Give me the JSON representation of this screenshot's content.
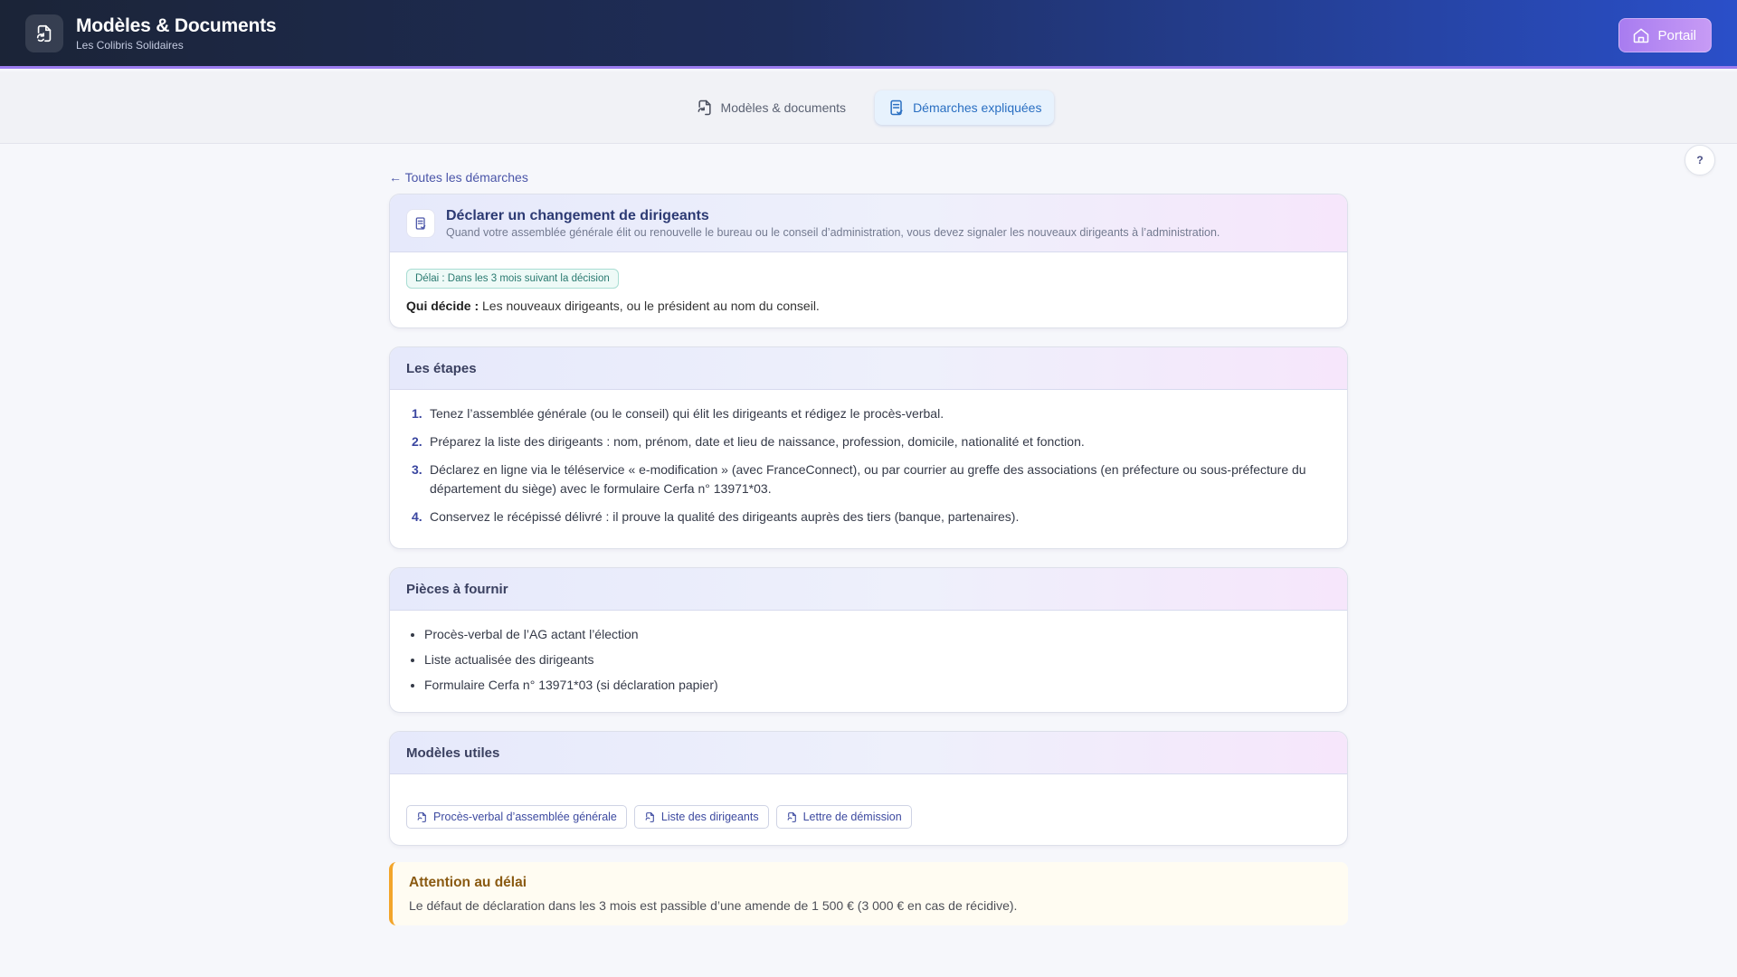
{
  "header": {
    "title": "Modèles & Documents",
    "subtitle": "Les Colibris Solidaires",
    "portal_label": "Portail"
  },
  "tabs": [
    {
      "label": "Modèles & documents",
      "icon": "document-icon",
      "active": false
    },
    {
      "label": "Démarches expliquées",
      "icon": "checklist-icon",
      "active": true
    }
  ],
  "help_label": "?",
  "back_link": "← Toutes les démarches",
  "procedure": {
    "title": "Déclarer un changement de dirigeants",
    "description": "Quand votre assemblée générale élit ou renouvelle le bureau ou le conseil d’administration, vous devez signaler les nouveaux dirigeants à l’administration.",
    "deadline_badge": "Délai : Dans les 3 mois suivant la décision",
    "who_label": "Qui décide :",
    "who_text": "Les nouveaux dirigeants, ou le président au nom du conseil."
  },
  "steps": {
    "heading": "Les étapes",
    "items": [
      {
        "num": "1.",
        "text": "Tenez l’assemblée générale (ou le conseil) qui élit les dirigeants et rédigez le procès-verbal."
      },
      {
        "num": "2.",
        "text": "Préparez la liste des dirigeants : nom, prénom, date et lieu de naissance, profession, domicile, nationalité et fonction."
      },
      {
        "num": "3.",
        "text": "Déclarez en ligne via le téléservice « e-modification » (avec FranceConnect), ou par courrier au greffe des associations (en préfecture ou sous-préfecture du département du siège) avec le formulaire Cerfa n° 13971*03."
      },
      {
        "num": "4.",
        "text": "Conservez le récépissé délivré : il prouve la qualité des dirigeants auprès des tiers (banque, partenaires)."
      }
    ]
  },
  "documents": {
    "heading": "Pièces à fournir",
    "items": [
      "Procès-verbal de l’AG actant l’élection",
      "Liste actualisée des dirigeants",
      "Formulaire Cerfa n° 13971*03 (si déclaration papier)"
    ]
  },
  "templates": {
    "heading": "Modèles utiles",
    "items": [
      "Procès-verbal d’assemblée générale",
      "Liste des dirigeants",
      "Lettre de démission"
    ]
  },
  "alert": {
    "title": "Attention au délai",
    "text": "Le défaut de déclaration dans les 3 mois est passible d’une amende de 1 500 € (3 000 € en cas de récidive)."
  }
}
